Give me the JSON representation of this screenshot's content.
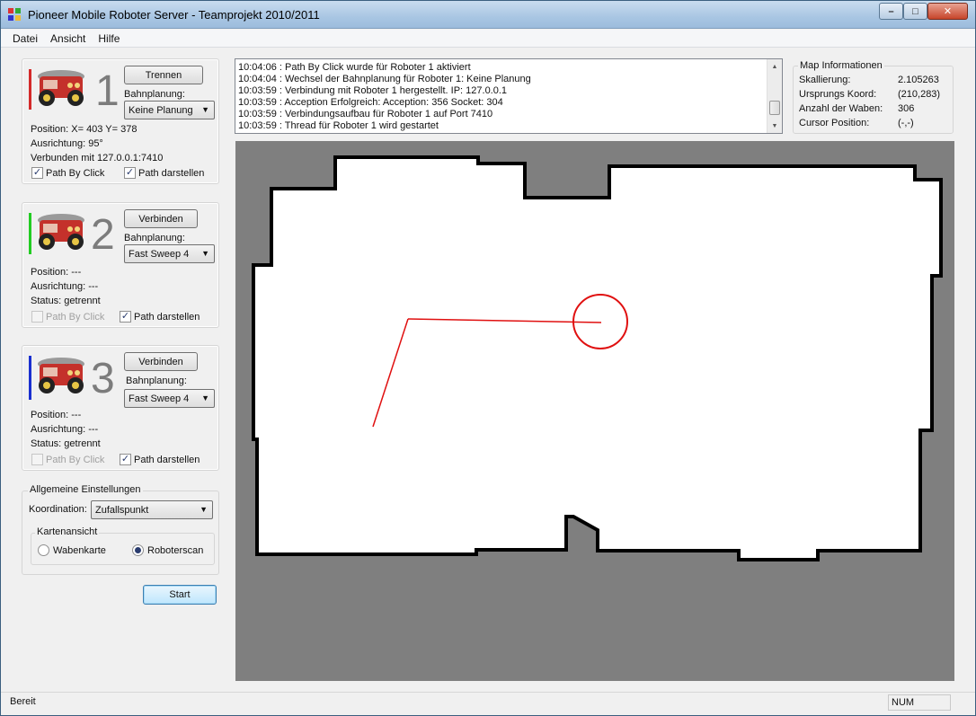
{
  "window": {
    "title": "Pioneer Mobile Roboter Server - Teamprojekt 2010/2011",
    "minimize": "–",
    "maximize": "□",
    "close": "✕"
  },
  "menu": [
    "Datei",
    "Ansicht",
    "Hilfe"
  ],
  "robots": [
    {
      "number": "1",
      "color": "#d42a2a",
      "button_label": "Trennen",
      "bahnplanung_label": "Bahnplanung:",
      "bahnplanung_value": "Keine Planung",
      "info": [
        "Position: X= 403 Y= 378",
        "Ausrichtung: 95°",
        "Verbunden mit 127.0.0.1:7410"
      ],
      "path_by_click": {
        "label": "Path By Click",
        "checked": true,
        "enabled": true
      },
      "path_darstellen": {
        "label": "Path darstellen",
        "checked": true,
        "enabled": true
      }
    },
    {
      "number": "2",
      "color": "#22cc22",
      "button_label": "Verbinden",
      "bahnplanung_label": "Bahnplanung:",
      "bahnplanung_value": "Fast Sweep 4",
      "info": [
        "Position: ---",
        "Ausrichtung: ---",
        "Status: getrennt"
      ],
      "path_by_click": {
        "label": "Path By Click",
        "checked": false,
        "enabled": false
      },
      "path_darstellen": {
        "label": "Path darstellen",
        "checked": true,
        "enabled": true
      }
    },
    {
      "number": "3",
      "color": "#1a2fd0",
      "button_label": "Verbinden",
      "bahnplanung_label": "Bahnplanung:",
      "bahnplanung_value": "Fast Sweep 4",
      "info": [
        "Position: ---",
        "Ausrichtung: ---",
        "Status: getrennt"
      ],
      "path_by_click": {
        "label": "Path By Click",
        "checked": false,
        "enabled": false
      },
      "path_darstellen": {
        "label": "Path darstellen",
        "checked": true,
        "enabled": true
      }
    }
  ],
  "settings": {
    "legend": "Allgemeine Einstellungen",
    "koordination_label": "Koordination:",
    "koordination_value": "Zufallspunkt",
    "kartenansicht_legend": "Kartenansicht",
    "radio_wabenkarte": "Wabenkarte",
    "radio_roboterscan": "Roboterscan",
    "selected": "Roboterscan"
  },
  "start_button": "Start",
  "log": [
    "10:04:06 : Path By Click wurde für Roboter 1 aktiviert",
    "10:04:04 : Wechsel der Bahnplanung für Roboter 1: Keine Planung",
    "10:03:59 : Verbindung mit Roboter 1 hergestellt. IP: 127.0.0.1",
    "10:03:59 : Acception Erfolgreich: Acception: 356 Socket: 304",
    "10:03:59 : Verbindungsaufbau für Roboter 1 auf Port 7410",
    "10:03:59 : Thread für Roboter 1 wird gestartet"
  ],
  "map_info": {
    "legend": "Map Informationen",
    "rows": [
      {
        "label": "Skallierung:",
        "value": "2.105263"
      },
      {
        "label": "Ursprungs Koord:",
        "value": "(210,283)"
      },
      {
        "label": "Anzahl der Waben:",
        "value": "306"
      },
      {
        "label": "Cursor Position:",
        "value": "(-,-)"
      }
    ]
  },
  "status": {
    "text": "Bereit",
    "num": "NUM"
  }
}
